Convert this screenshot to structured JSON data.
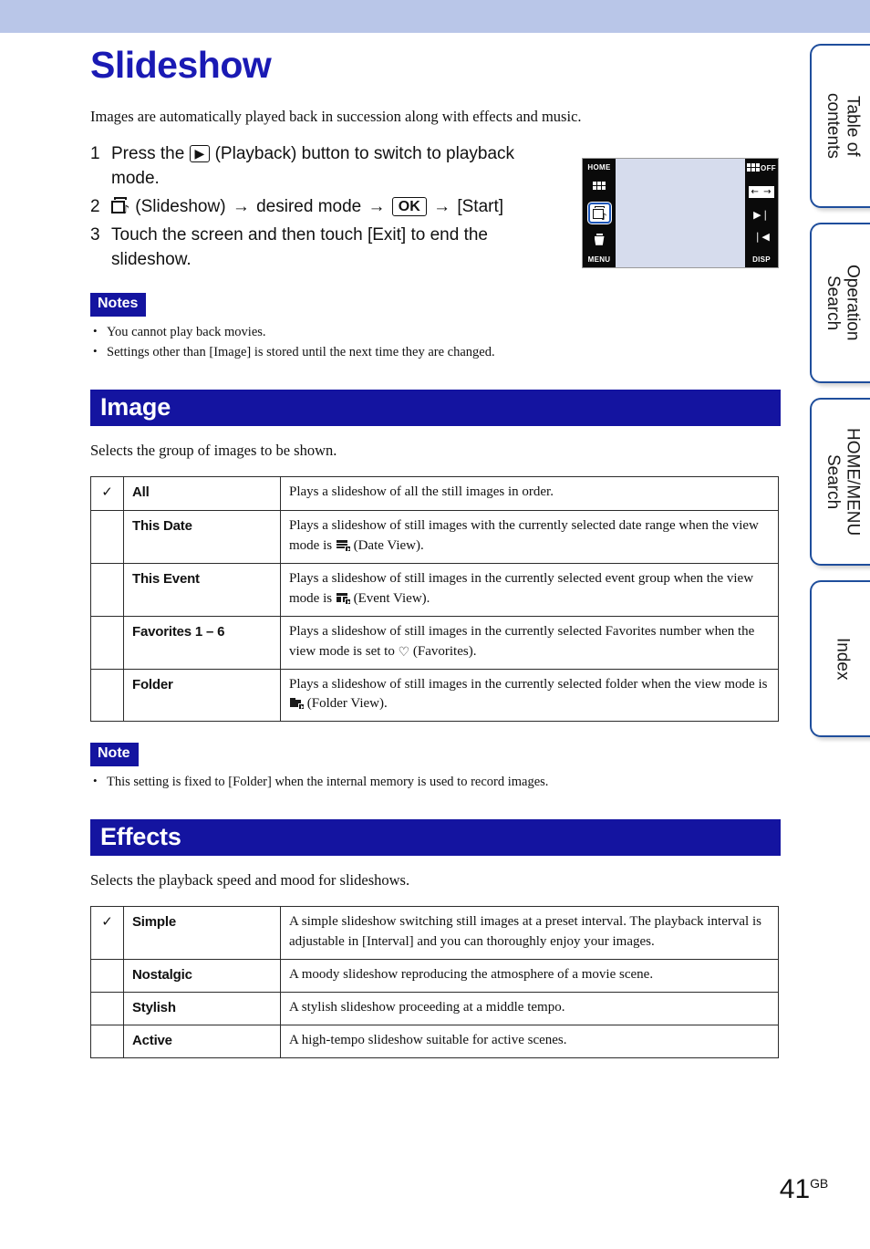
{
  "page": {
    "title": "Slideshow",
    "intro": "Images are automatically played back in succession along with effects and music.",
    "page_number": "41",
    "page_suffix": "GB",
    "accent_color": "#1414a0",
    "title_color": "#1a1ab4",
    "top_band_color": "#b9c6e8"
  },
  "steps": [
    {
      "num": "1",
      "pre": "Press the",
      "icon": "playback-icon",
      "icon_glyph": "▶",
      "post": "(Playback) button to switch to playback mode."
    },
    {
      "num": "2",
      "icon": "slideshow-icon",
      "label": "(Slideshow)",
      "arrow1": "→",
      "mode": "desired mode",
      "arrow2": "→",
      "ok": "OK",
      "arrow3": "→",
      "tail": "[Start]"
    },
    {
      "num": "3",
      "text": "Touch the screen and then touch [Exit] to end the slideshow."
    }
  ],
  "camera_screen": {
    "left_items": [
      {
        "name": "home-label",
        "text": "HOME"
      },
      {
        "name": "index-grid-icon",
        "text": ""
      },
      {
        "name": "slideshow-icon-selected",
        "text": ""
      },
      {
        "name": "delete-icon",
        "text": ""
      },
      {
        "name": "menu-label",
        "text": "MENU"
      }
    ],
    "right_items": [
      {
        "name": "display-off-indicator",
        "text": "OFF"
      },
      {
        "name": "left-right-arrows-icon",
        "text": "← →"
      },
      {
        "name": "next-icon",
        "text": "▶❘"
      },
      {
        "name": "previous-icon",
        "text": "❘◀"
      },
      {
        "name": "disp-label",
        "text": "DISP"
      }
    ]
  },
  "notes_block": {
    "badge": "Notes",
    "items": [
      "You cannot play back movies.",
      "Settings other than [Image] is stored until the next time they are changed."
    ]
  },
  "image_section": {
    "header": "Image",
    "description": "Selects the group of images to be shown.",
    "rows": [
      {
        "checked": true,
        "check_glyph": "✓",
        "name": "All",
        "desc_parts": [
          {
            "type": "text",
            "value": "Plays a slideshow of all the still images in order."
          }
        ]
      },
      {
        "checked": false,
        "name": "This Date",
        "desc_parts": [
          {
            "type": "text",
            "value": "Plays a slideshow of still images with the currently selected date range when the view mode is "
          },
          {
            "type": "icon",
            "value": "date-view-icon"
          },
          {
            "type": "text",
            "value": " (Date View)."
          }
        ]
      },
      {
        "checked": false,
        "name": "This Event",
        "desc_parts": [
          {
            "type": "text",
            "value": "Plays a slideshow of still images in the currently selected event group when the view mode is "
          },
          {
            "type": "icon",
            "value": "event-view-icon"
          },
          {
            "type": "text",
            "value": " (Event View)."
          }
        ]
      },
      {
        "checked": false,
        "name": "Favorites 1 – 6",
        "desc_parts": [
          {
            "type": "text",
            "value": "Plays a slideshow of still images in the currently selected Favorites number when the view mode is set to "
          },
          {
            "type": "icon",
            "value": "favorites-heart-icon"
          },
          {
            "type": "text",
            "value": " (Favorites)."
          }
        ]
      },
      {
        "checked": false,
        "name": "Folder",
        "desc_parts": [
          {
            "type": "text",
            "value": "Plays a slideshow of still images in the currently selected folder when the view mode is "
          },
          {
            "type": "icon",
            "value": "folder-view-icon"
          },
          {
            "type": "text",
            "value": " (Folder View)."
          }
        ]
      }
    ]
  },
  "note_block": {
    "badge": "Note",
    "items": [
      "This setting is fixed to [Folder] when the internal memory is used to record images."
    ]
  },
  "effects_section": {
    "header": "Effects",
    "description": "Selects the playback speed and mood for slideshows.",
    "rows": [
      {
        "checked": true,
        "check_glyph": "✓",
        "name": "Simple",
        "desc": "A simple slideshow switching still images at a preset interval. The playback interval is adjustable in [Interval] and you can thoroughly enjoy your images."
      },
      {
        "checked": false,
        "name": "Nostalgic",
        "desc": "A moody slideshow reproducing the atmosphere of a movie scene."
      },
      {
        "checked": false,
        "name": "Stylish",
        "desc": "A stylish slideshow proceeding at a middle tempo."
      },
      {
        "checked": false,
        "name": "Active",
        "desc": "A high-tempo slideshow suitable for active scenes."
      }
    ]
  },
  "side_tabs": [
    {
      "label": "Table of\ncontents"
    },
    {
      "label": "Operation\nSearch"
    },
    {
      "label": "HOME/MENU\nSearch"
    },
    {
      "label": "Index"
    }
  ]
}
